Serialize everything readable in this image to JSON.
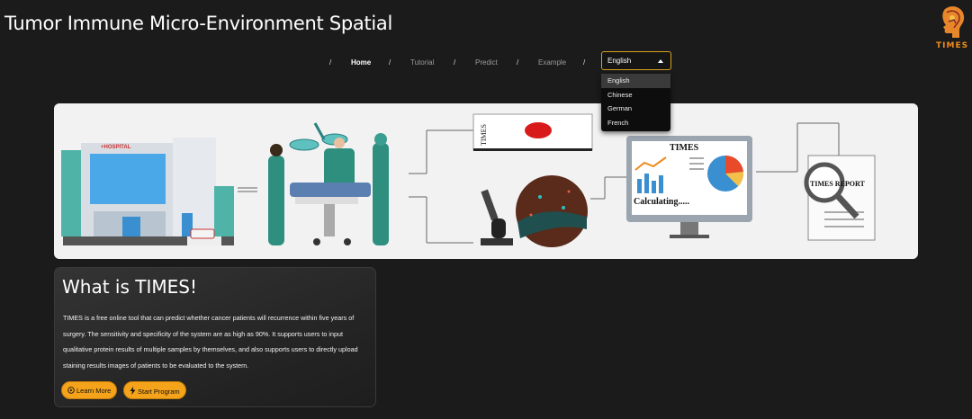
{
  "app": {
    "title": "Tumor Immune Micro-Environment Spatial"
  },
  "logo": {
    "text": "TIMES"
  },
  "nav": {
    "separator": "/",
    "items": [
      {
        "label": "Home",
        "active": true
      },
      {
        "label": "Tutorial",
        "active": false
      },
      {
        "label": "Predict",
        "active": false
      },
      {
        "label": "Example",
        "active": false
      }
    ]
  },
  "language": {
    "selected": "English",
    "options": [
      "English",
      "Chinese",
      "German",
      "French"
    ]
  },
  "banner": {
    "hospital_sign": "+HOSPITAL",
    "slide_label": "TIMES",
    "monitor_title": "TIMES",
    "monitor_status": "Calculating.....",
    "report_label": "TIMES  REPORT"
  },
  "intro": {
    "title": "What is TIMES!",
    "body": "TIMES is a free online tool that can predict whether cancer patients will recurrence within five years of surgery. The sensitivity and specificity of the system are as high as 90%. It supports users to input qualitative protein results of multiple samples by themselves, and also supports users to directly upload staining results images of patients to be evaluated to the system.",
    "learn_more_label": "Learn More",
    "start_program_label": "Start Program"
  },
  "colors": {
    "accent": "#f5a31a",
    "dropdown_border": "#d9a21e",
    "logo_orange": "#f08a1c",
    "background": "#1b1b1b"
  },
  "icons": {
    "learn_more": "play-circle-icon",
    "start_program": "lightning-icon",
    "dropdown": "caret-up-icon"
  }
}
